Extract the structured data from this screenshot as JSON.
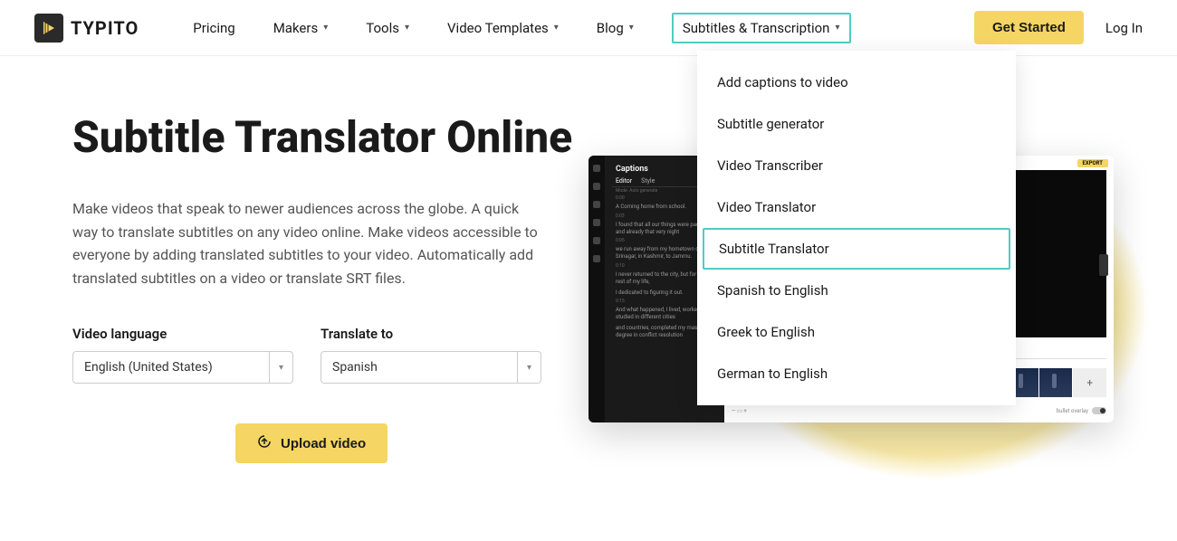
{
  "brand": "TYPITO",
  "nav": {
    "pricing": "Pricing",
    "makers": "Makers",
    "tools": "Tools",
    "video_templates": "Video Templates",
    "blog": "Blog",
    "subtitles": "Subtitles & Transcription"
  },
  "actions": {
    "get_started": "Get Started",
    "login": "Log In"
  },
  "dropdown": {
    "items": [
      "Add captions to video",
      "Subtitle generator",
      "Video Transcriber",
      "Video Translator",
      "Subtitle Translator",
      "Spanish to English",
      "Greek to English",
      "German to English"
    ]
  },
  "hero": {
    "title": "Subtitle Translator Online",
    "desc": "Make videos that speak to newer audiences across the globe. A quick way to translate subtitles on any video online. Make videos accessible to everyone by adding translated subtitles to your video. Automatically add translated subtitles on a video or translate SRT files."
  },
  "selects": {
    "lang_label": "Video language",
    "lang_value": "English (United States)",
    "to_label": "Translate to",
    "to_value": "Spanish"
  },
  "upload": "Upload video",
  "preview": {
    "captions_header": "Captions",
    "tab_editor": "Editor",
    "tab_style": "Style",
    "mode": "Mode: Auto generate",
    "export": "EXPORT",
    "add_thumb": "+",
    "bottom_label": "bullet overlay",
    "lines": [
      "A Coming home from school.",
      "I found that all our things were packed and already that very night",
      "we run away from my hometown of Srinagar, in Kashmir, to Jammu.",
      "I never returned to the city, but for the rest of my life,",
      "I dedicated to figuring it out.",
      "And what happened, I lived, worked, studied in different cities",
      "and countries, completed my master's degree in conflict resolution"
    ],
    "timecodes": [
      "0:00",
      "0:03",
      "0:05",
      "0:10",
      "0:15"
    ]
  }
}
